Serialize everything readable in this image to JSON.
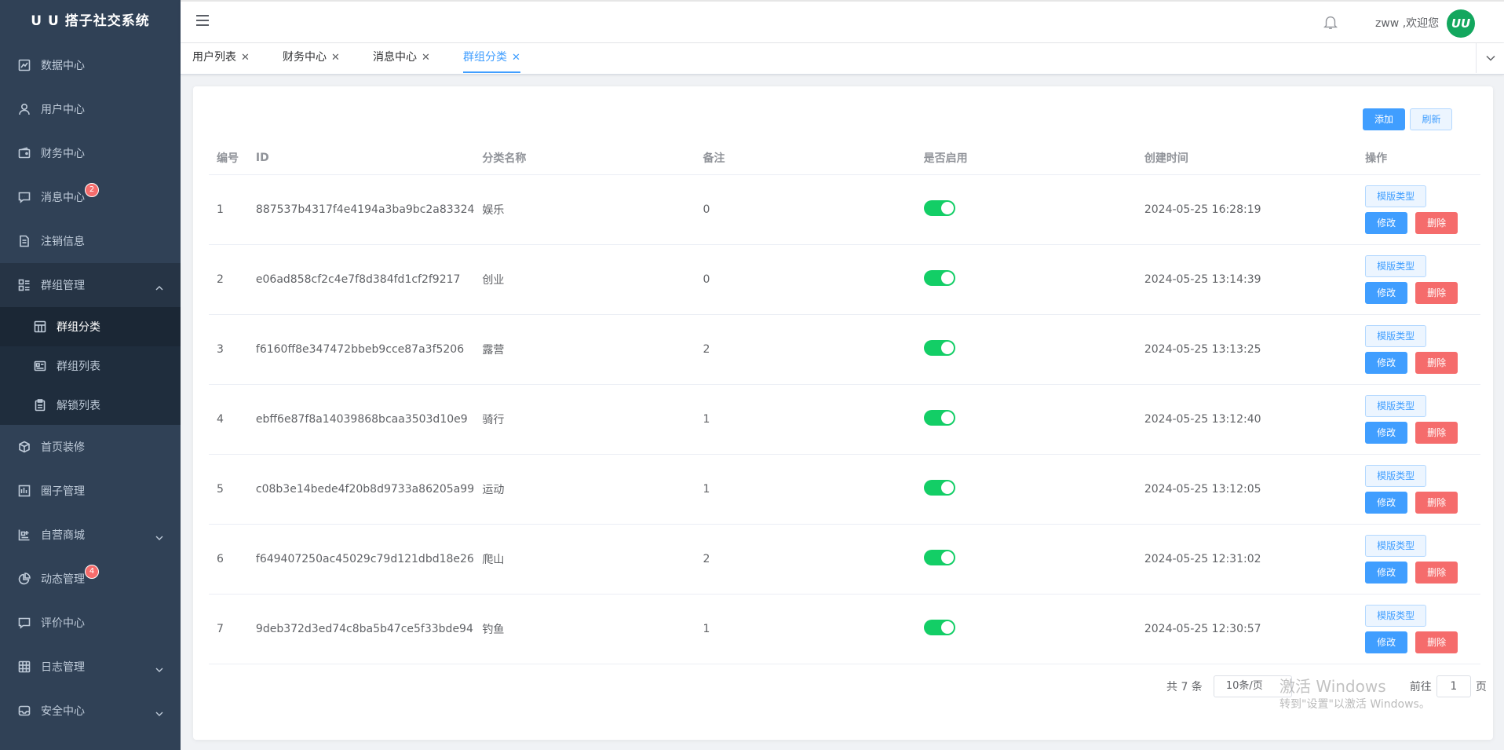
{
  "app": {
    "title": "U U 搭子社交系统"
  },
  "sidebar": {
    "items": [
      {
        "label": "数据中心",
        "icon": "chart-icon"
      },
      {
        "label": "用户中心",
        "icon": "user-icon"
      },
      {
        "label": "财务中心",
        "icon": "wallet-icon"
      },
      {
        "label": "消息中心",
        "icon": "message-icon",
        "badge": "2"
      },
      {
        "label": "注销信息",
        "icon": "document-icon"
      },
      {
        "label": "群组管理",
        "icon": "group-icon",
        "expanded": true
      },
      {
        "label": "首页装修",
        "icon": "cube-icon"
      },
      {
        "label": "圈子管理",
        "icon": "board-icon"
      },
      {
        "label": "自营商城",
        "icon": "shop-icon"
      },
      {
        "label": "动态管理",
        "icon": "pie-icon",
        "badge": "4"
      },
      {
        "label": "评价中心",
        "icon": "comment-icon"
      },
      {
        "label": "日志管理",
        "icon": "grid-icon"
      },
      {
        "label": "安全中心",
        "icon": "shield-icon"
      }
    ],
    "group_submenu": [
      {
        "label": "群组分类",
        "icon": "table-icon"
      },
      {
        "label": "群组列表",
        "icon": "id-card-icon"
      },
      {
        "label": "解锁列表",
        "icon": "clipboard-icon"
      }
    ]
  },
  "header": {
    "welcome": "zww ,欢迎您",
    "avatar_text": "UU"
  },
  "tabs": [
    {
      "label": "用户列表"
    },
    {
      "label": "财务中心"
    },
    {
      "label": "消息中心"
    },
    {
      "label": "群组分类",
      "active": true
    }
  ],
  "toolbar": {
    "add_label": "添加",
    "refresh_label": "刷新"
  },
  "table": {
    "headers": [
      "编号",
      "ID",
      "分类名称",
      "备注",
      "是否启用",
      "创建时间",
      "操作"
    ],
    "rows": [
      {
        "no": "1",
        "id": "887537b4317f4e4194a3ba9bc2a83324",
        "name": "娱乐",
        "remark": "0",
        "enabled": true,
        "created": "2024-05-25 16:28:19"
      },
      {
        "no": "2",
        "id": "e06ad858cf2c4e7f8d384fd1cf2f9217",
        "name": "创业",
        "remark": "0",
        "enabled": true,
        "created": "2024-05-25 13:14:39"
      },
      {
        "no": "3",
        "id": "f6160ff8e347472bbeb9cce87a3f5206",
        "name": "露营",
        "remark": "2",
        "enabled": true,
        "created": "2024-05-25 13:13:25"
      },
      {
        "no": "4",
        "id": "ebff6e87f8a14039868bcaa3503d10e9",
        "name": "骑行",
        "remark": "1",
        "enabled": true,
        "created": "2024-05-25 13:12:40"
      },
      {
        "no": "5",
        "id": "c08b3e14bede4f20b8d9733a86205a99",
        "name": "运动",
        "remark": "1",
        "enabled": true,
        "created": "2024-05-25 13:12:05"
      },
      {
        "no": "6",
        "id": "f649407250ac45029c79d121dbd18e26",
        "name": "爬山",
        "remark": "2",
        "enabled": true,
        "created": "2024-05-25 12:31:02"
      },
      {
        "no": "7",
        "id": "9deb372d3ed74c8ba5b47ce5f33bde94",
        "name": "钓鱼",
        "remark": "1",
        "enabled": true,
        "created": "2024-05-25 12:30:57"
      }
    ],
    "op_template_label": "模版类型",
    "op_edit_label": "修改",
    "op_delete_label": "删除"
  },
  "pagination": {
    "total": "共 7 条",
    "page_size": "10条/页",
    "goto_label": "前往",
    "page_value": "1",
    "page_suffix": "页"
  },
  "watermark": {
    "line1": "激活 Windows",
    "line2": "转到\"设置\"以激活 Windows。"
  },
  "colors": {
    "sidebar_bg": "#304156",
    "primary": "#409eff",
    "danger": "#f56c6c",
    "switch_on": "#13ce66",
    "avatar": "#13a75e"
  }
}
